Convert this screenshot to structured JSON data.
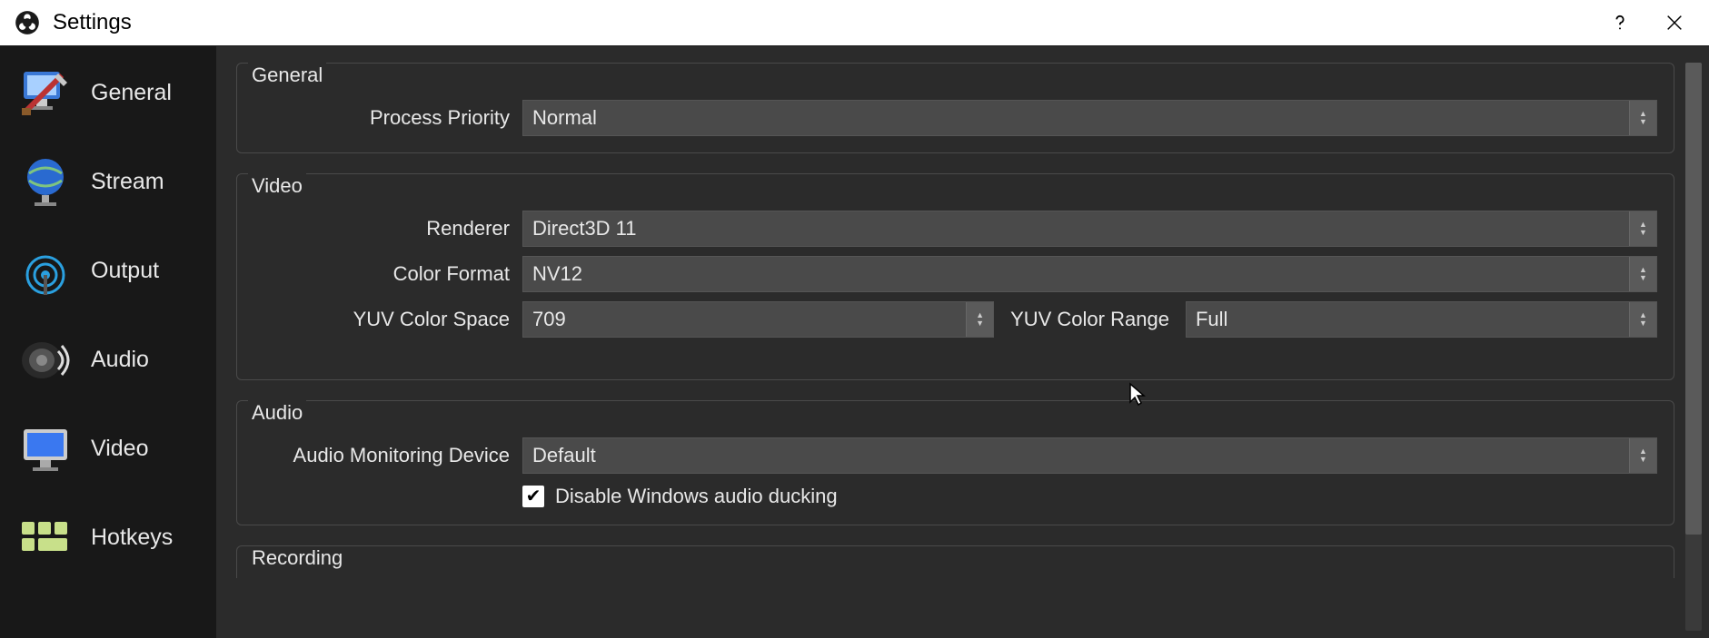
{
  "window": {
    "title": "Settings"
  },
  "sidebar": {
    "items": [
      {
        "label": "General"
      },
      {
        "label": "Stream"
      },
      {
        "label": "Output"
      },
      {
        "label": "Audio"
      },
      {
        "label": "Video"
      },
      {
        "label": "Hotkeys"
      }
    ]
  },
  "groups": {
    "general": {
      "title": "General",
      "process_priority": {
        "label": "Process Priority",
        "value": "Normal"
      }
    },
    "video": {
      "title": "Video",
      "renderer": {
        "label": "Renderer",
        "value": "Direct3D 11"
      },
      "color_format": {
        "label": "Color Format",
        "value": "NV12"
      },
      "yuv_color_space": {
        "label": "YUV Color Space",
        "value": "709"
      },
      "yuv_color_range": {
        "label": "YUV Color Range",
        "value": "Full"
      }
    },
    "audio": {
      "title": "Audio",
      "monitoring_device": {
        "label": "Audio Monitoring Device",
        "value": "Default"
      },
      "disable_ducking": {
        "label": "Disable Windows audio ducking",
        "checked": true
      }
    },
    "recording": {
      "title": "Recording"
    }
  }
}
